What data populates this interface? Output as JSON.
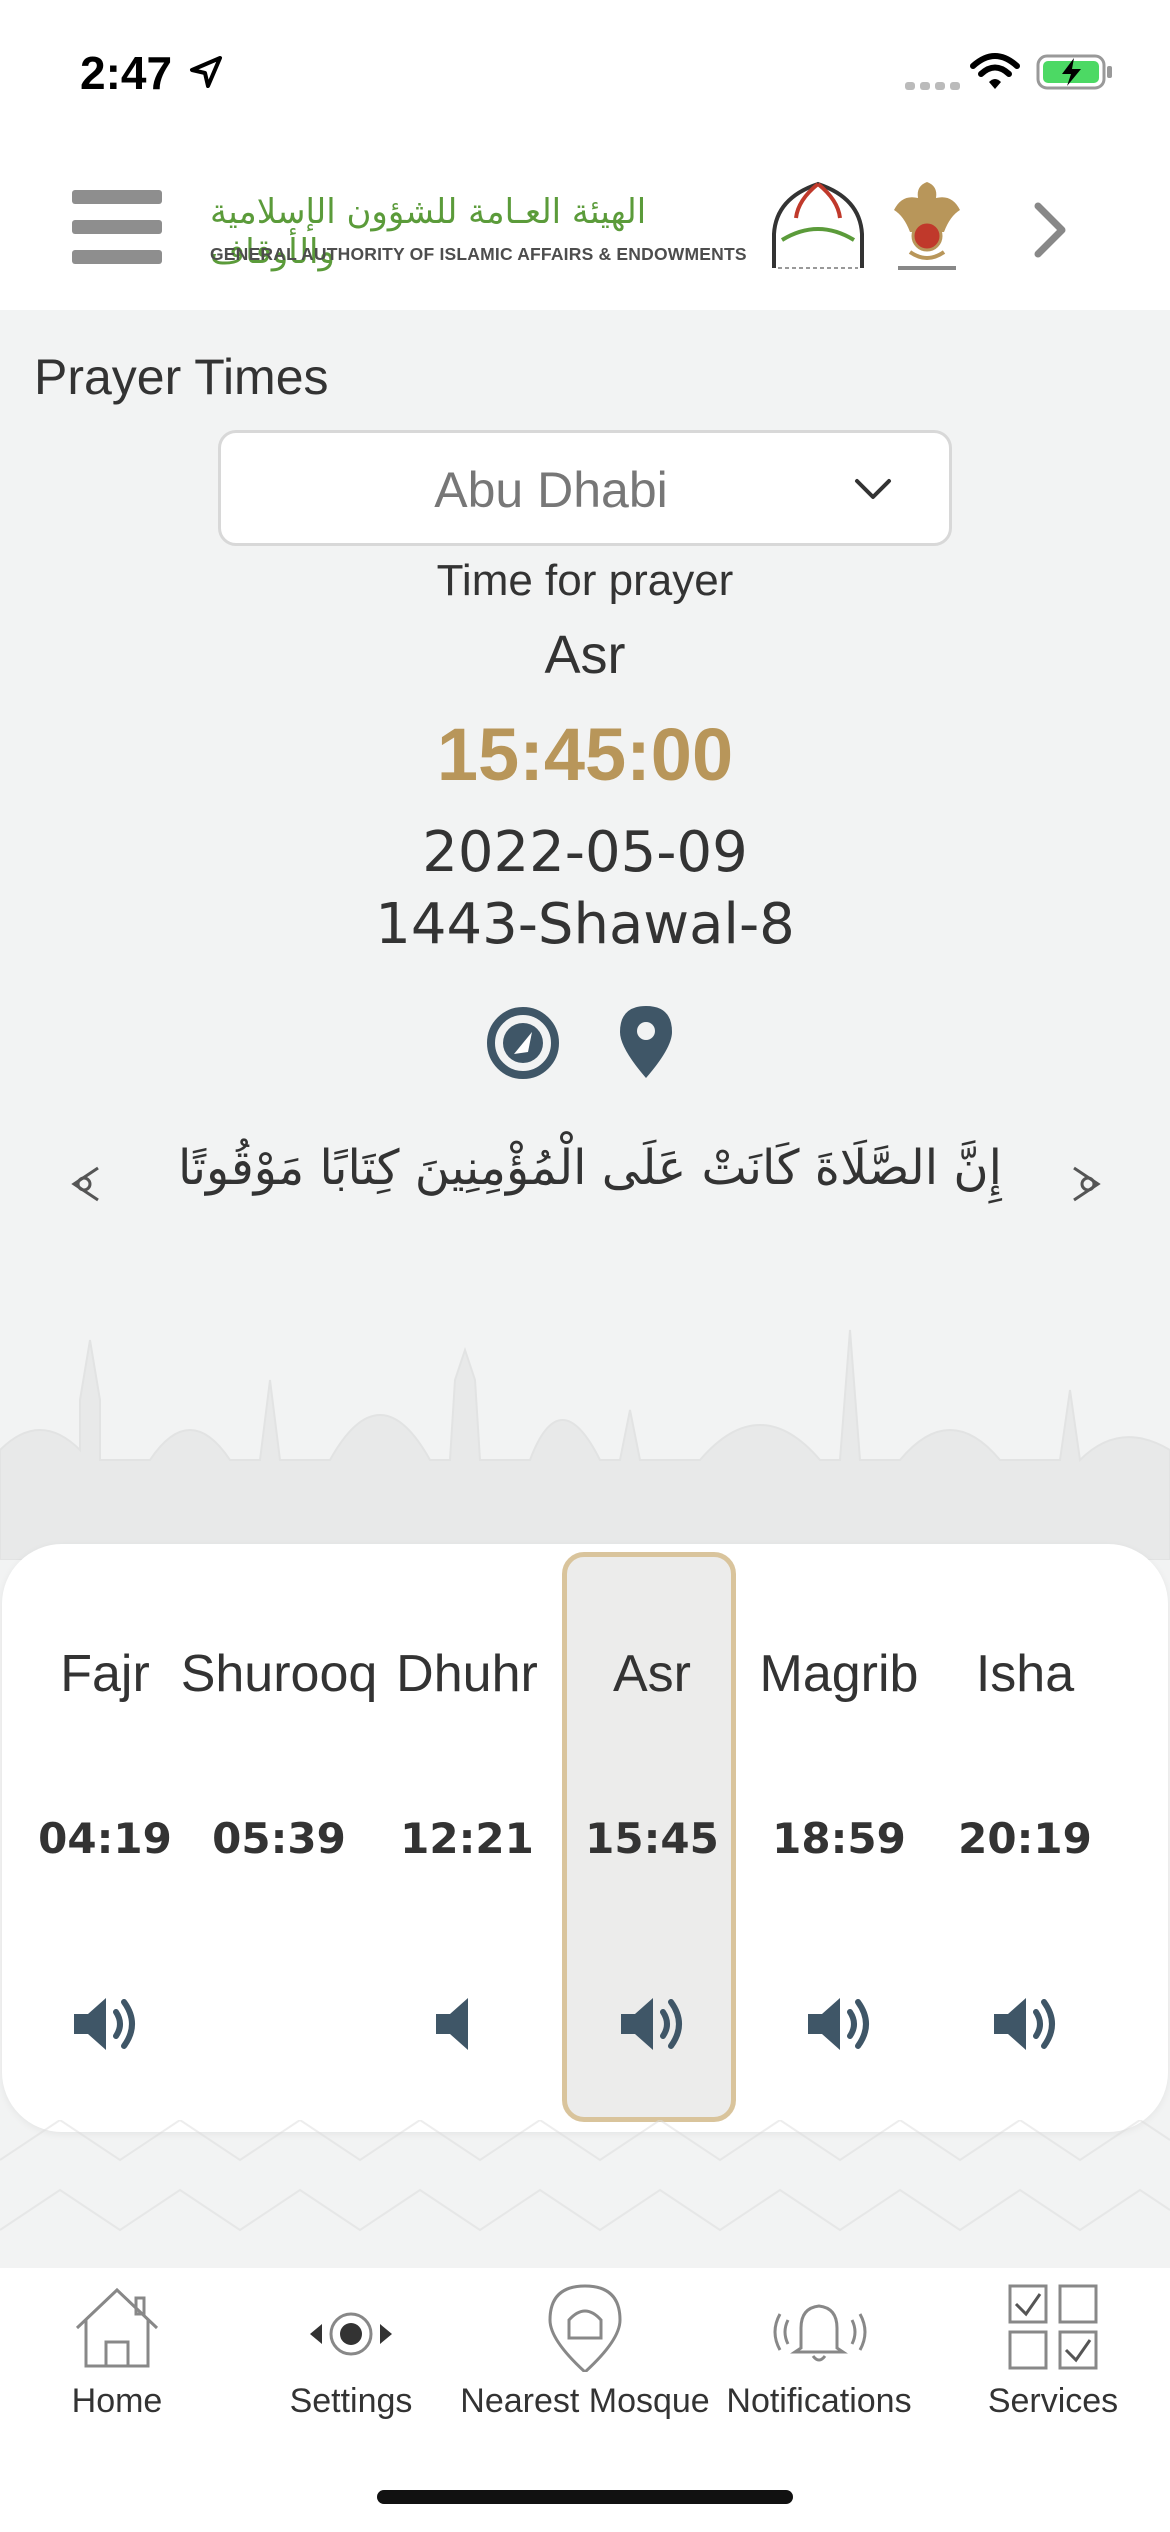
{
  "status_bar": {
    "time": "2:47"
  },
  "header": {
    "logo_arabic": "الهيئة العـامة للشؤون الإسلامية والأوقاف",
    "logo_english": "GENERAL AUTHORITY OF ISLAMIC AFFAIRS & ENDOWMENTS",
    "icons": [
      "menu-icon",
      "mosque-logo",
      "uae-emblem",
      "chevron-right-icon"
    ]
  },
  "page": {
    "title": "Prayer Times",
    "city": "Abu Dhabi",
    "time_for_prayer_label": "Time for prayer",
    "current_prayer": "Asr",
    "countdown": "15:45:00",
    "gregorian_date": "2022-05-09",
    "hijri_date": "1443-Shawal-8",
    "verse": "إِنَّ الصَّلَاةَ كَانَتْ عَلَى الْمُؤْمِنِينَ كِتَابًا مَوْقُوتًا"
  },
  "prayers": [
    {
      "name": "Fajr",
      "time": "04:19",
      "sound": "full",
      "active": false
    },
    {
      "name": "Shurooq",
      "time": "05:39",
      "sound": "none",
      "active": false
    },
    {
      "name": "Dhuhr",
      "time": "12:21",
      "sound": "mute",
      "active": false
    },
    {
      "name": "Asr",
      "time": "15:45",
      "sound": "full",
      "active": true
    },
    {
      "name": "Magrib",
      "time": "18:59",
      "sound": "full",
      "active": false
    },
    {
      "name": "Isha",
      "time": "20:19",
      "sound": "full",
      "active": false
    }
  ],
  "tabbar": {
    "home": "Home",
    "settings": "Settings",
    "nearest_mosque": "Nearest Mosque",
    "notifications": "Notifications",
    "services": "Services"
  },
  "colors": {
    "accent_gold": "#b8965a",
    "icon_slate": "#3f5667",
    "logo_green": "#5b9b3a"
  }
}
